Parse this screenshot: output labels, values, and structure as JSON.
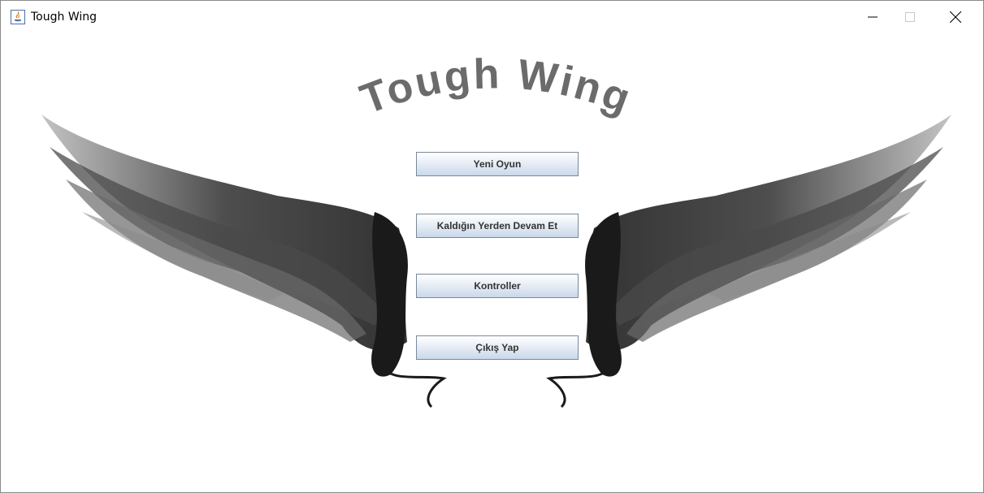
{
  "window": {
    "title": "Tough Wing",
    "controls": {
      "minimize": "minimize-icon",
      "maximize": "maximize-icon",
      "close": "close-icon"
    }
  },
  "logo": {
    "text": "Tough Wing",
    "color": "#6b6b6b"
  },
  "menu": {
    "new_game": "Yeni Oyun",
    "continue": "Kaldığın Yerden Devam Et",
    "controls": "Kontroller",
    "exit": "Çıkış Yap"
  },
  "colors": {
    "button_border": "#7a8a99",
    "button_gradient_top": "#ffffff",
    "button_gradient_bottom": "#c9d8ea",
    "wing_dark": "#2a2a2a"
  }
}
